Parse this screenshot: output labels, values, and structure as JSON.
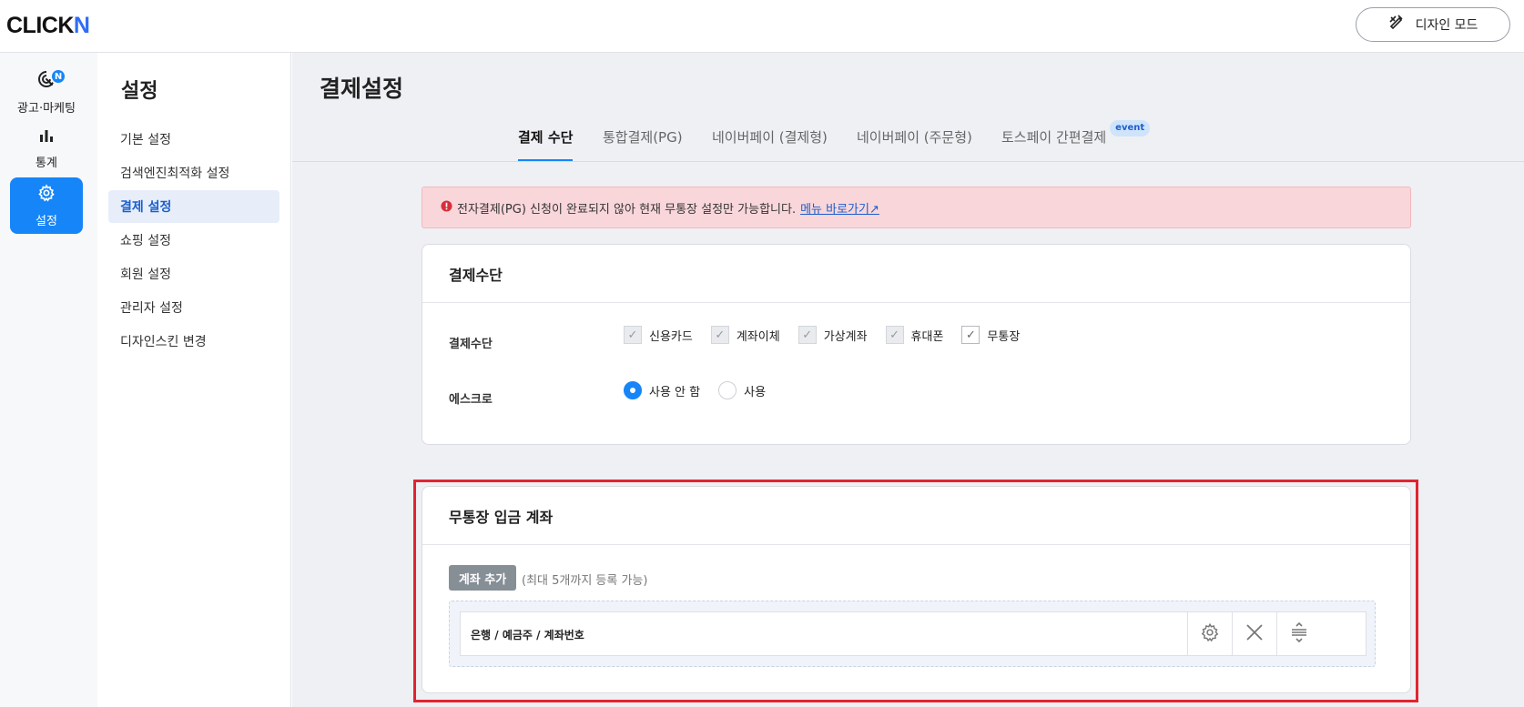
{
  "header": {
    "logo_main": "CLICK",
    "logo_accent": "N",
    "design_mode_label": "디자인 모드"
  },
  "rail": {
    "items": [
      {
        "label": "광고·마케팅",
        "icon": "marketing-icon",
        "badge": "N"
      },
      {
        "label": "통계",
        "icon": "bar-chart-icon"
      },
      {
        "label": "설정",
        "icon": "gear-icon",
        "active": true
      }
    ]
  },
  "sidebar": {
    "title": "설정",
    "items": [
      {
        "label": "기본 설정"
      },
      {
        "label": "검색엔진최적화 설정"
      },
      {
        "label": "결제 설정",
        "active": true
      },
      {
        "label": "쇼핑 설정"
      },
      {
        "label": "회원 설정"
      },
      {
        "label": "관리자 설정"
      },
      {
        "label": "디자인스킨 변경"
      }
    ]
  },
  "main": {
    "title": "결제설정",
    "tabs": [
      {
        "label": "결제 수단",
        "active": true
      },
      {
        "label": "통합결제(PG)"
      },
      {
        "label": "네이버페이 (결제형)"
      },
      {
        "label": "네이버페이 (주문형)"
      },
      {
        "label": "토스페이 간편결제",
        "badge": "event"
      }
    ],
    "alert": {
      "text": "전자결제(PG) 신청이 완료되지 않아 현재 무통장 설정만 가능합니다.",
      "link": "메뉴 바로가기↗",
      "color": "#f9d6da"
    },
    "payment_card": {
      "title": "결제수단",
      "methods_label": "결제수단",
      "methods": [
        {
          "label": "신용카드",
          "checked": true,
          "disabled": true
        },
        {
          "label": "계좌이체",
          "checked": true,
          "disabled": true
        },
        {
          "label": "가상계좌",
          "checked": true,
          "disabled": true
        },
        {
          "label": "휴대폰",
          "checked": true,
          "disabled": true
        },
        {
          "label": "무통장",
          "checked": true,
          "disabled": false
        }
      ],
      "escrow_label": "에스크로",
      "escrow_options": [
        {
          "label": "사용 안 함",
          "selected": true
        },
        {
          "label": "사용",
          "selected": false
        }
      ]
    },
    "bank_card": {
      "title": "무통장 입금 계좌",
      "add_button": "계좌 추가",
      "add_hint": "(최대 5개까지 등록 가능)",
      "account_placeholder": "은행 / 예금주 / 계좌번호"
    }
  },
  "colors": {
    "accent": "#1685f8",
    "highlight_frame": "#e12530"
  }
}
